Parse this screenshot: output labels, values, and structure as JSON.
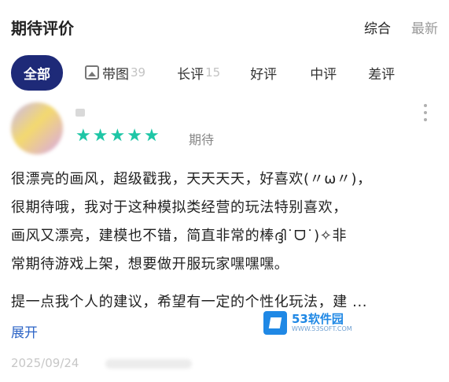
{
  "header": {
    "title": "期待评价",
    "sort_options": [
      "综合",
      "最新"
    ]
  },
  "tabs": [
    {
      "label": "全部",
      "count": ""
    },
    {
      "label": "带图",
      "count": "39",
      "icon": "image-icon"
    },
    {
      "label": "长评",
      "count": "15"
    },
    {
      "label": "好评",
      "count": ""
    },
    {
      "label": "中评",
      "count": ""
    },
    {
      "label": "差评",
      "count": ""
    }
  ],
  "review": {
    "rating_stars": 5,
    "rating_label": "期待",
    "body_lines": [
      "很漂亮的画风，超级戳我，天天天天，好喜欢(〃ω〃)，",
      "很期待哦，我对于这种模拟类经营的玩法特别喜欢，",
      "画风又漂亮，建模也不错，简直非常的棒ദ്ദി˙ᗜ˙)✧非",
      "常期待游戏上架，想要做开服玩家嘿嘿嘿。"
    ],
    "suggestion": "提一点我个人的建议，希望有一定的个性化玩法，建 ...",
    "expand_label": "展开",
    "date": "2025/09/24"
  },
  "watermark": {
    "name": "53软件园",
    "url": "WWW.53SOFT.COM"
  },
  "colors": {
    "tab_active_bg": "#1e2a78",
    "star": "#1ec6a6",
    "link": "#2c64c6"
  }
}
